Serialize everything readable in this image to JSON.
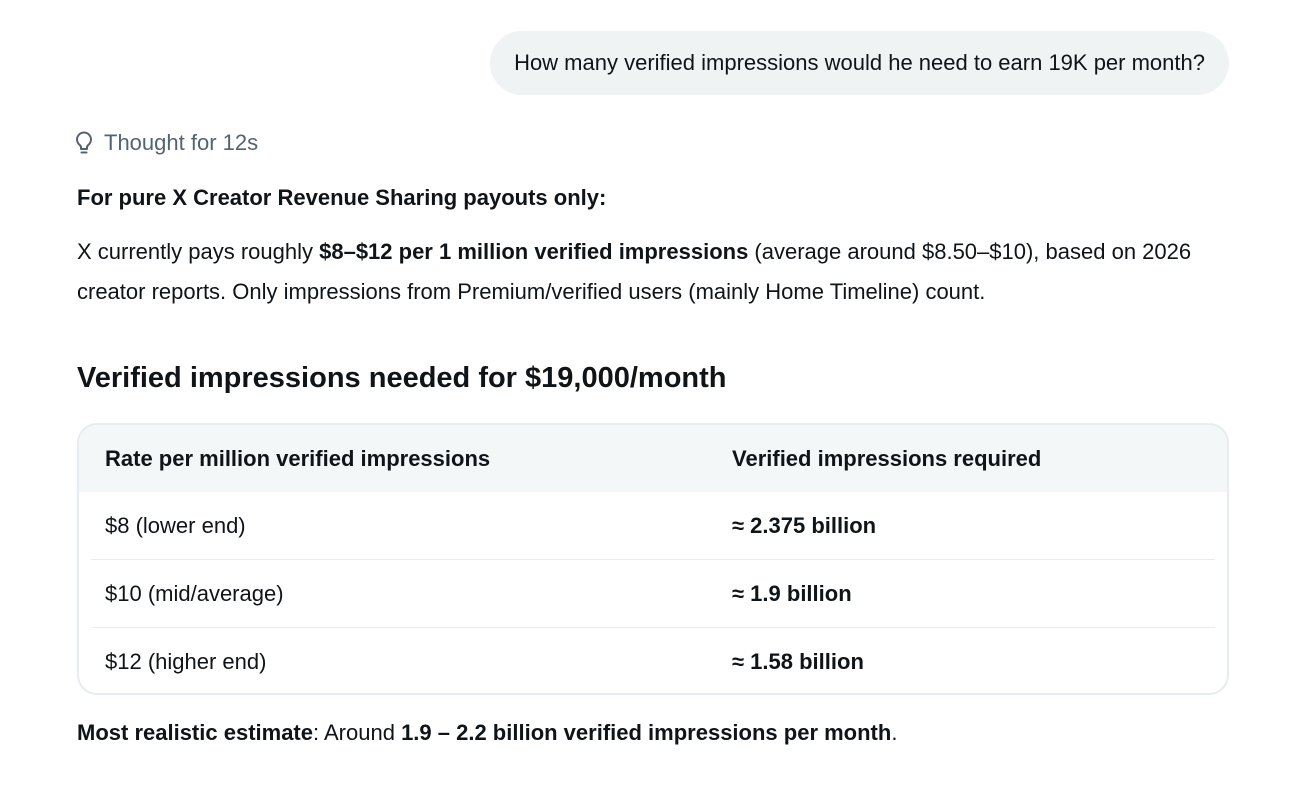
{
  "user_message": "How many verified impressions would he need to earn 19K per month?",
  "thought": {
    "icon": "lightbulb-icon",
    "label": "Thought for 12s"
  },
  "response": {
    "intro_heading": "For pure X Creator Revenue Sharing payouts only:",
    "paragraph": {
      "part1": "X currently pays roughly ",
      "bold": "$8–$12 per 1 million verified impressions",
      "part2": " (average around $8.50–$10), based on 2026 creator reports. Only impressions from Premium/verified users (mainly Home Timeline) count."
    },
    "section_title": "Verified impressions needed for $19,000/month",
    "table": {
      "headers": [
        "Rate per million verified impressions",
        "Verified impressions required"
      ],
      "rows": [
        [
          "$8 (lower end)",
          "≈ 2.375 billion"
        ],
        [
          "$10 (mid/average)",
          "≈ 1.9 billion"
        ],
        [
          "$12 (higher end)",
          "≈ 1.58 billion"
        ]
      ]
    },
    "summary": {
      "label": "Most realistic estimate",
      "middle": ": Around ",
      "value": "1.9 – 2.2 billion verified impressions per month",
      "end": "."
    }
  }
}
